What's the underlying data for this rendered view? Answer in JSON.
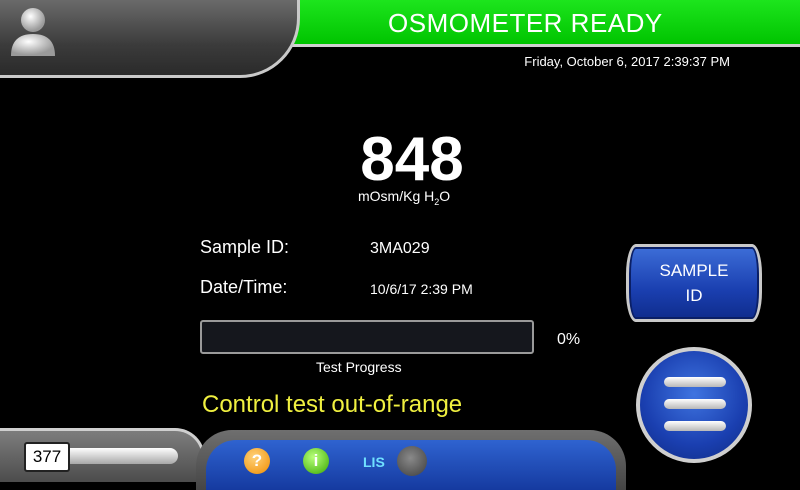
{
  "header": {
    "status": "OSMOMETER READY",
    "datetime": "Friday, October 6, 2017 2:39:37 PM",
    "status_color": "#00c400"
  },
  "reading": {
    "value": "848",
    "unit_prefix": "mOsm/Kg H",
    "unit_sub": "2",
    "unit_suffix": "O"
  },
  "sample": {
    "id_label": "Sample ID:",
    "id_value": "3MA029",
    "datetime_label": "Date/Time:",
    "datetime_value": "10/6/17 2:39 PM"
  },
  "progress": {
    "percent": 0,
    "percent_text": "0%",
    "label": "Test Progress"
  },
  "warning": {
    "text": "Control test out-of-range",
    "color": "#f0f040"
  },
  "buttons": {
    "sample_id_line1": "SAMPLE",
    "sample_id_line2": "ID",
    "menu_icon": "hamburger-icon"
  },
  "footer": {
    "counter": "377",
    "help_glyph": "?",
    "info_glyph": "i",
    "lis_label": "LIS",
    "lis_status": "off"
  },
  "icons": [
    "user-icon",
    "help-icon",
    "info-icon",
    "lis-status-icon",
    "hamburger-icon"
  ]
}
